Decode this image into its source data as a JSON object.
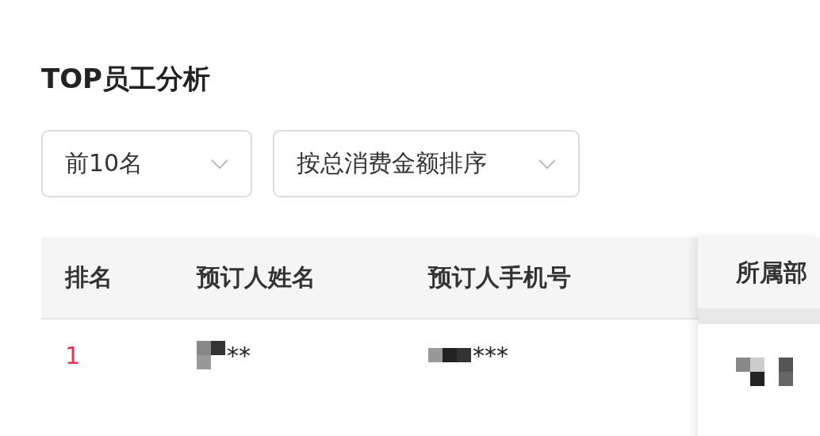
{
  "title": "TOP员工分析",
  "filters": [
    {
      "value": "前10名"
    },
    {
      "value": "按总消费金额排序"
    }
  ],
  "table": {
    "columns": [
      "排名",
      "预订人姓名",
      "预订人手机号"
    ],
    "fixed_column": "所属部",
    "rows": [
      {
        "rank": "1",
        "name": "**",
        "phone": "***"
      }
    ]
  }
}
